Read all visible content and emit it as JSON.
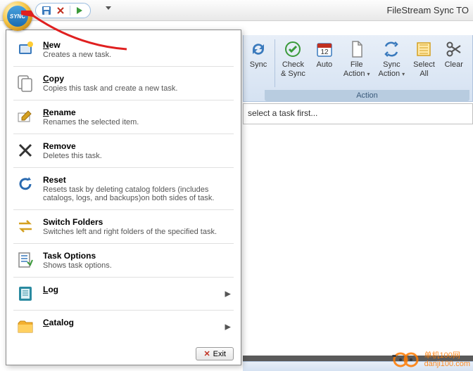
{
  "app_title": "FileStream Sync TO",
  "orb_label": "SYNC",
  "ribbon": {
    "group_label": "Action",
    "buttons": [
      {
        "label": "Sync",
        "icon": "sync"
      },
      {
        "label": "Check\n& Sync",
        "icon": "checksync"
      },
      {
        "label": "Auto",
        "icon": "calendar"
      },
      {
        "label": "File\nAction",
        "icon": "file",
        "dd": true
      },
      {
        "label": "Sync\nAction",
        "icon": "syncaction",
        "dd": true
      },
      {
        "label": "Select\nAll",
        "icon": "selectall"
      },
      {
        "label": "Clear",
        "icon": "scissors"
      }
    ]
  },
  "content_msg": "select a task first...",
  "menu": {
    "items": [
      {
        "title": "New",
        "u": "N",
        "rest": "ew",
        "desc": "Creates a new task.",
        "icon": "new"
      },
      {
        "title": "Copy",
        "u": "C",
        "rest": "opy",
        "desc": "Copies this task and create a new task.",
        "icon": "copy"
      },
      {
        "title": "Rename",
        "u": "R",
        "rest": "ename",
        "desc": "Renames the selected item.",
        "icon": "rename"
      },
      {
        "title": "Remove",
        "u": "",
        "rest": "Remove",
        "desc": "Deletes this task.",
        "icon": "remove"
      },
      {
        "title": "Reset",
        "u": "",
        "rest": "Reset",
        "desc": "Resets task by deleting catalog folders (includes catalogs, logs, and backups)on both sides of task.",
        "icon": "reset"
      },
      {
        "title": "Switch Folders",
        "u": "",
        "rest": "Switch Folders",
        "desc": "Switches left and right folders of the specified task.",
        "icon": "switch"
      },
      {
        "title": "Task Options",
        "u": "",
        "rest": "Task Options",
        "desc": "Shows task options.",
        "icon": "options"
      },
      {
        "title": "Log",
        "u": "L",
        "rest": "og",
        "desc": "",
        "icon": "log",
        "submenu": true
      },
      {
        "title": "Catalog",
        "u": "C",
        "rest": "atalog",
        "desc": "",
        "icon": "catalog",
        "submenu": true
      }
    ],
    "exit_label": "Exit"
  },
  "watermark": {
    "line1": "单机100网",
    "line2": "danji100.com"
  }
}
